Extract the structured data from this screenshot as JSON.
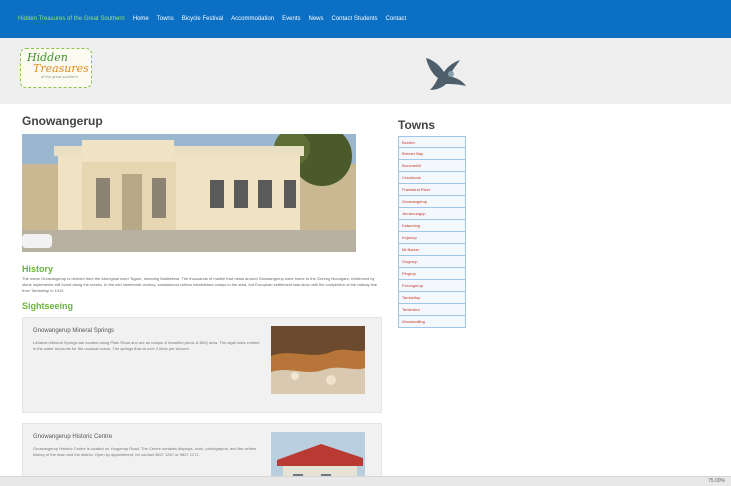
{
  "nav": {
    "items": [
      {
        "label": "Hidden Treasures of the Great Southern",
        "active": true
      },
      {
        "label": "Home"
      },
      {
        "label": "Towns"
      },
      {
        "label": "Bicycle Festival"
      },
      {
        "label": "Accommodation"
      },
      {
        "label": "Events"
      },
      {
        "label": "News"
      },
      {
        "label": "Contact Students"
      },
      {
        "label": "Contact"
      }
    ]
  },
  "logo": {
    "line1": "Hidden",
    "line2": "Treasures",
    "tagline": "of the great southern"
  },
  "main": {
    "title": "Gnowangerup",
    "history_heading": "History",
    "history_text": "The name Gnowangerup is derived from the Aboriginal word 'Ngow', meaning Malleefowl. The thousands of mallee fowl nests around Gnowangerup were home to the Goreng Noongars, evidenced by stone implements still found along the creeks. In the mid nineteenth century, sandalwood cutters established camps in the area, but European settlement was slow until the completion of the railway line from Tambellup in 1912.",
    "sightseeing_heading": "Sightseeing",
    "cards": [
      {
        "title": "Gnowangerup Mineral Springs",
        "text": "Lebanon Mineral Springs are located along Plain Road and are an unique & beautiful picnic & BBQ area. The algal mats evident in the water accounts for the unusual colour. The springs flow at over 2 litres per second."
      },
      {
        "title": "Gnowangerup Historic Centre",
        "text": "Gnowangerup Historic Centre is located on Yougenup Road. The Centre contains displays, tools, photographs, and the written history of the town and the district. Open by appointment, for contact 9827 1267 or 9827 1271."
      }
    ]
  },
  "towns": {
    "title": "Towns",
    "items": [
      "Borden",
      "Bremer Bay",
      "Broomehill",
      "Cranbrook",
      "Frankland River",
      "Gnowangerup",
      "Jerramungup",
      "Katanning",
      "Kojonup",
      "Mt Barker",
      "Ongerup",
      "Pingrup",
      "Porongurup",
      "Tambellup",
      "Tenterden",
      "Woodanilling"
    ]
  },
  "statusbar": {
    "zoom": "75.00%"
  },
  "colors": {
    "nav_bg": "#0b6fc4",
    "nav_active": "#9be07a",
    "heading_green": "#6cb33f",
    "town_link": "#c0392b"
  }
}
